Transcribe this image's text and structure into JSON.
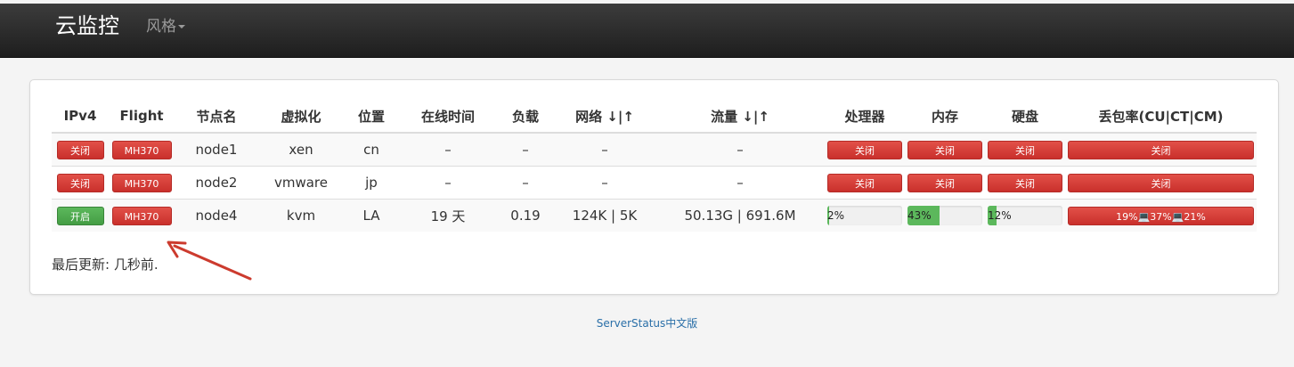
{
  "navbar": {
    "brand": "云监控",
    "style_menu": "风格"
  },
  "table": {
    "headers": [
      "IPv4",
      "Flight",
      "节点名",
      "虚拟化",
      "位置",
      "在线时间",
      "负载",
      "网络 ↓|↑",
      "流量 ↓|↑",
      "处理器",
      "内存",
      "硬盘",
      "丢包率(CU|CT|CM)"
    ],
    "rows": [
      {
        "ipv4": "关闭",
        "ipv4_status": "off",
        "flight": "MH370",
        "name": "node1",
        "virt": "xen",
        "location": "cn",
        "uptime": "–",
        "load": "–",
        "network": "–",
        "traffic": "–",
        "cpu": "关闭",
        "mem": "关闭",
        "hdd": "关闭",
        "loss": "关闭"
      },
      {
        "ipv4": "关闭",
        "ipv4_status": "off",
        "flight": "MH370",
        "name": "node2",
        "virt": "vmware",
        "location": "jp",
        "uptime": "–",
        "load": "–",
        "network": "–",
        "traffic": "–",
        "cpu": "关闭",
        "mem": "关闭",
        "hdd": "关闭",
        "loss": "关闭"
      },
      {
        "ipv4": "开启",
        "ipv4_status": "on",
        "flight": "MH370",
        "name": "node4",
        "virt": "kvm",
        "location": "LA",
        "uptime": "19 天",
        "load": "0.19",
        "network": "124K | 5K",
        "traffic": "50.13G | 691.6M",
        "cpu_text": "2%",
        "cpu_pct": 2,
        "mem_text": "43%",
        "mem_pct": 43,
        "hdd_text": "12%",
        "hdd_pct": 12,
        "loss_cu": "19%",
        "loss_ct": "37%",
        "loss_cm": "21%"
      }
    ]
  },
  "last_update": "最后更新: 几秒前.",
  "footer": {
    "link": "ServerStatus中文版"
  },
  "colors": {
    "red": "#d9534f",
    "green": "#5cb85c",
    "annotation_arrow": "#cc3b2e"
  },
  "icons": {
    "loss_separator": "laptop-icon",
    "annotation": "arrow-icon"
  }
}
